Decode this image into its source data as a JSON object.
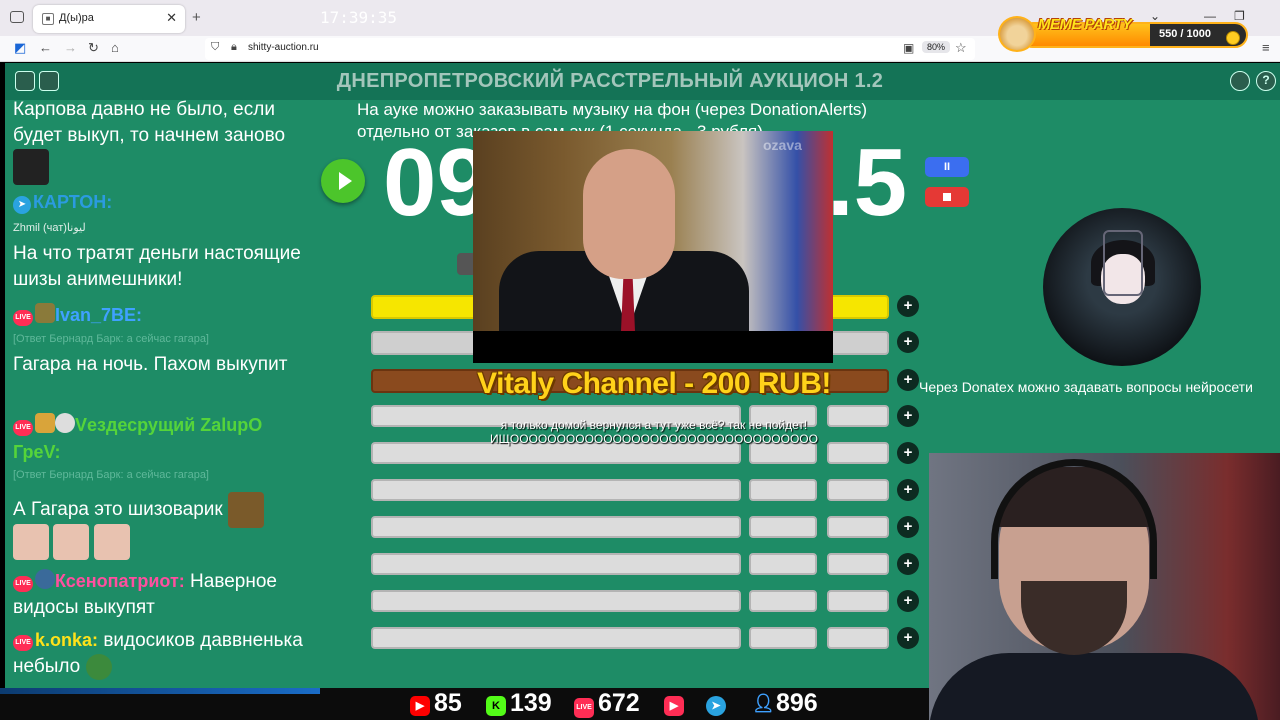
{
  "browser": {
    "tab_title": "Д(ы)ра",
    "url": "shitty-auction.ru",
    "zoom": "80%"
  },
  "meme_party": {
    "title": "MEME PARTY",
    "count": "550 / 1000",
    "accent": "#ffb21a"
  },
  "header": {
    "title": "ДНЕПРОПЕТРОВСКИЙ РАССТРЕЛЬНЫЙ АУКЦИОН 1.2"
  },
  "chat": {
    "messages": [
      {
        "text": "Карпова давно не было, если будет выкуп, то начнем заново"
      },
      {
        "user": "КАРТОН:",
        "platform": "telegram",
        "sub": "Zhmil (чат)ليونا"
      },
      {
        "text": "На что тратят деньги настоящие шизы анимешники!"
      },
      {
        "user": "Ivan_7BE:",
        "platform": "live",
        "sub": "[Ответ Бернард Барк: а сейчас гагара]"
      },
      {
        "text": "Гагара на ночь. Пахом выкупит"
      },
      {
        "user": "Vездесрущий ZalupO ГреV:",
        "platform": "live",
        "sub": "[Ответ Бернард Барк: а сейчас гагара]"
      },
      {
        "text": "А Гагара это шизоварик"
      },
      {
        "user": "Ксенопатриот:",
        "platform": "live",
        "text": "Наверное видосы выкупят"
      },
      {
        "user": "k.onka:",
        "platform": "live",
        "text": "видосиков даввненька небыло"
      }
    ]
  },
  "auction": {
    "info_line_1": "На ауке можно заказывать музыку на фон (через DonationAlerts)",
    "info_line_2": "отдельно от заказов в сам аук (1 секунда - 3 рубля)",
    "timer_left": "09",
    "timer_right": ".5",
    "pause_label": "II",
    "add_label": "+",
    "lot_count": 10
  },
  "donation": {
    "title": "Vitaly Channel - 200 RUB!",
    "message_1": "я только домой вернулся а тут уже всё? так не пойдет!",
    "message_2": "ИЩООООООООООООООООООООООООООООООООО"
  },
  "video": {
    "logo": "ozava"
  },
  "ticker": {
    "text": "Через Donatex можно задавать вопросы нейросети"
  },
  "stats": {
    "clock": "17:39:35",
    "youtube": "85",
    "kick": "139",
    "live": "672",
    "other": "",
    "telegram": "",
    "viewers": "896"
  }
}
